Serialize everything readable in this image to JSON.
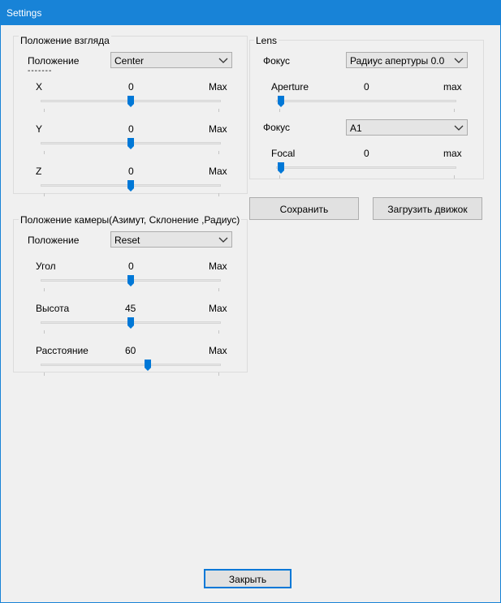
{
  "window": {
    "title": "Settings",
    "accent": "#1883d7",
    "slider_color": "#0078d7"
  },
  "view_group": {
    "title": "Положение взгляда",
    "position_label": "Положение",
    "dashes": "-------",
    "position_value": "Center",
    "sliders": [
      {
        "label": "X",
        "value": "0",
        "max": "Max",
        "fraction": 0.5
      },
      {
        "label": "Y",
        "value": "0",
        "max": "Max",
        "fraction": 0.5
      },
      {
        "label": "Z",
        "value": "0",
        "max": "Max",
        "fraction": 0.5
      }
    ]
  },
  "camera_group": {
    "title": "Положение камеры(Азимут, Склонение ,Радиус)",
    "position_label": "Положение",
    "position_value": "Reset",
    "sliders": [
      {
        "label": "Угол",
        "value": "0",
        "max": "Max",
        "fraction": 0.5
      },
      {
        "label": "Высота",
        "value": "45",
        "max": "Max",
        "fraction": 0.5
      },
      {
        "label": "Расстояние",
        "value": "60",
        "max": "Max",
        "fraction": 0.6
      }
    ]
  },
  "lens_group": {
    "title": "Lens",
    "focus_label_1": "Фокус",
    "focus_value_1": "Радиус апертуры 0.0",
    "aperture": {
      "label": "Aperture",
      "value": "0",
      "max": "max",
      "fraction": 0.0
    },
    "focus_label_2": "Фокус",
    "focus_value_2": "A1",
    "focal": {
      "label": "Focal",
      "value": "0",
      "max": "max",
      "fraction": 0.0
    }
  },
  "buttons": {
    "save": "Сохранить",
    "load": "Загрузить движок",
    "close": "Закрыть"
  },
  "icons": {
    "dropdown": "chevron-down-icon",
    "slider_thumb": "slider-thumb-icon"
  }
}
